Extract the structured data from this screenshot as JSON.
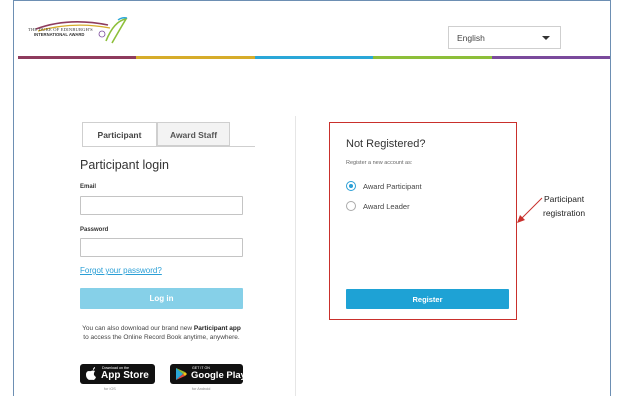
{
  "header": {
    "logo_line1": "THE DUKE OF EDINBURGH'S",
    "logo_line2": "INTERNATIONAL AWARD",
    "language": {
      "selected": "English"
    },
    "color_bar": [
      "#8e3b5d",
      "#d6ac2a",
      "#2aa7d8",
      "#8dbf3a",
      "#7a4a9c"
    ]
  },
  "login": {
    "tabs": [
      {
        "label": "Participant",
        "active": true
      },
      {
        "label": "Award Staff",
        "active": false
      }
    ],
    "title": "Participant login",
    "email_label": "Email",
    "email_value": "",
    "password_label": "Password",
    "password_value": "",
    "forgot_link": "Forgot your password?",
    "login_button": "Log in",
    "app_text_pre": "You can also download our brand new ",
    "app_text_bold": "Participant app",
    "app_text_post": " to access the Online Record Book anytime, anywhere.",
    "app_store": {
      "small": "Download on the",
      "big": "App Store",
      "sub": "for iOS"
    },
    "google_play": {
      "small": "GET IT ON",
      "big": "Google Play",
      "sub": "for Android"
    }
  },
  "registration": {
    "title": "Not Registered?",
    "subtitle": "Register a new account as:",
    "options": [
      {
        "label": "Award Participant",
        "checked": true
      },
      {
        "label": "Award Leader",
        "checked": false
      }
    ],
    "register_button": "Register"
  },
  "annotation": {
    "line1": "Participant",
    "line2": "registration",
    "color": "#c9302c"
  }
}
